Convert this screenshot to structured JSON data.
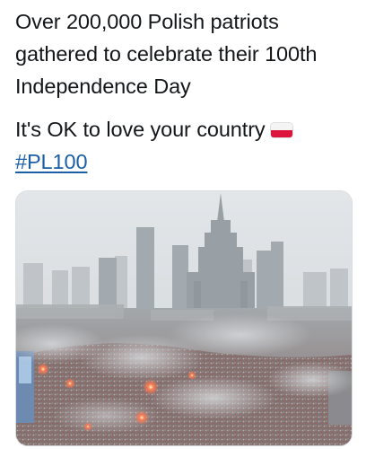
{
  "tweet": {
    "lines": [
      "Over 200,000 Polish patriots",
      "gathered to celebrate their 100th",
      "Independence Day"
    ],
    "line2": "It's OK to love your country",
    "flag_icon": "poland-flag-emoji",
    "hashtag": "#PL100"
  },
  "photo": {
    "subject": "aerial-crowd-city-smoke",
    "colors": {
      "sky": "#dfe3e5",
      "crowd": "#7a6763",
      "flare": "#ff5a3a",
      "smoke": "#c9cdd0"
    }
  }
}
